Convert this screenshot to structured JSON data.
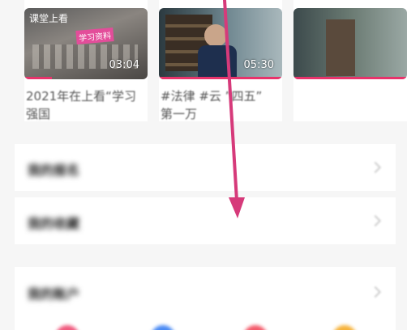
{
  "videos": [
    {
      "duration": "03:04",
      "overlay_title": "课堂上看",
      "badge": "学习资料",
      "caption": "2021年在上看“学习\n强国"
    },
    {
      "duration": "05:30",
      "caption": "#法律 #云 ”四五”\n第一万"
    },
    {
      "duration": "",
      "caption": ""
    }
  ],
  "settings_rows": [
    {
      "label": "我的报名"
    },
    {
      "label": "我的收藏"
    },
    {
      "label": "我的账户"
    }
  ],
  "colors": {
    "accent": "#e8336b",
    "arrow": "#d63a7a"
  }
}
